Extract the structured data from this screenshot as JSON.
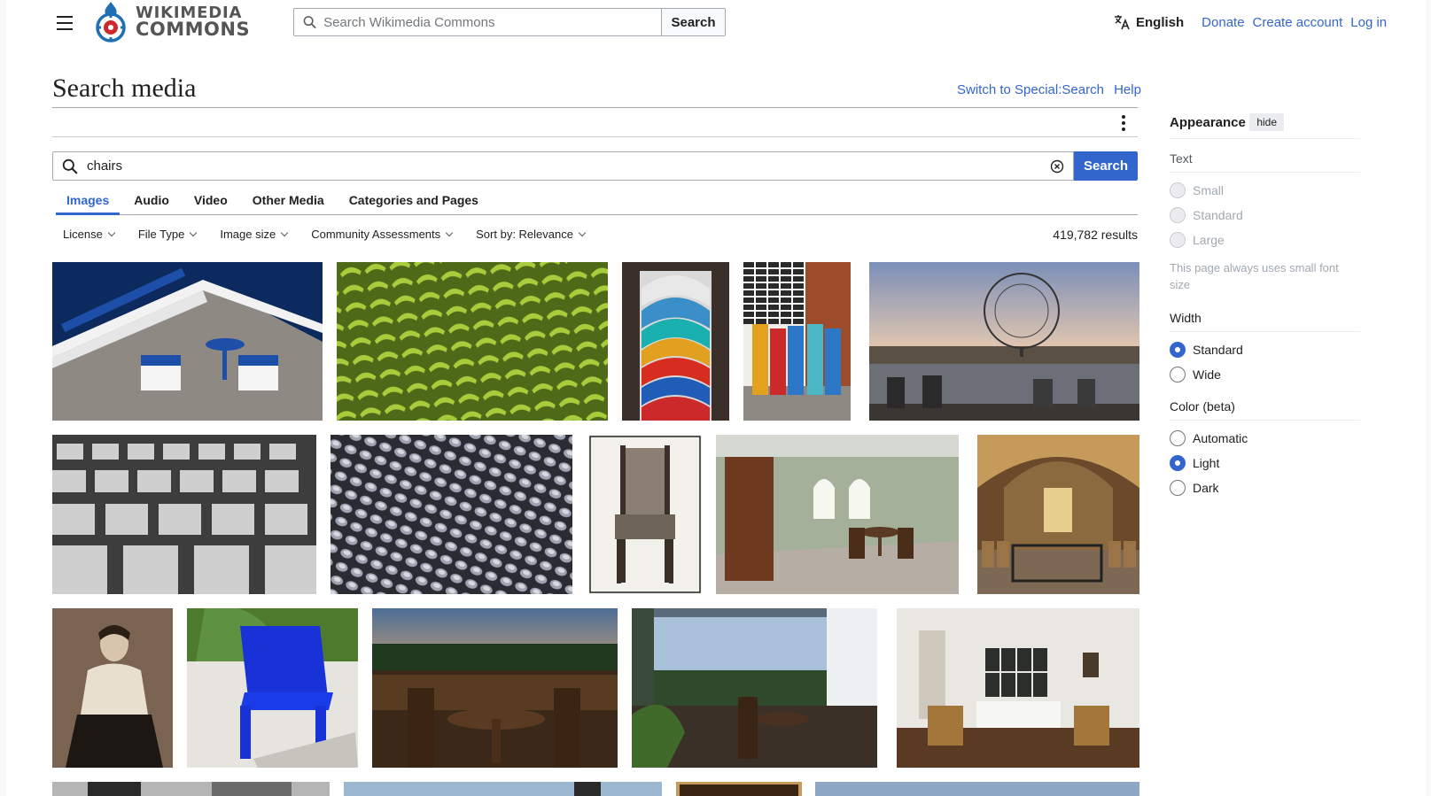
{
  "header": {
    "logo_line1": "WIKIMEDIA",
    "logo_line2": "COMMONS",
    "search_placeholder": "Search Wikimedia Commons",
    "search_button": "Search",
    "language": "English",
    "links": [
      "Donate",
      "Create account",
      "Log in"
    ]
  },
  "title": {
    "text": "Search media",
    "links": [
      "Switch to Special:Search",
      "Help"
    ]
  },
  "search": {
    "query": "chairs",
    "button": "Search"
  },
  "tabs": [
    {
      "label": "Images",
      "active": true
    },
    {
      "label": "Audio",
      "active": false
    },
    {
      "label": "Video",
      "active": false
    },
    {
      "label": "Other Media",
      "active": false
    },
    {
      "label": "Categories and Pages",
      "active": false
    }
  ],
  "filters": [
    "License",
    "File Type",
    "Image size",
    "Community Assessments",
    "Sort by: Relevance"
  ],
  "results": "419,782 results",
  "appearance": {
    "title": "Appearance",
    "hide": "hide",
    "text_section": "Text",
    "text_options": [
      "Small",
      "Standard",
      "Large"
    ],
    "text_note": "This page always uses small font size",
    "width_section": "Width",
    "width_options": [
      "Standard",
      "Wide"
    ],
    "width_selected": "Standard",
    "color_section": "Color (beta)",
    "color_options": [
      "Automatic",
      "Light",
      "Dark"
    ],
    "color_selected": "Light"
  },
  "colors": {
    "accent": "#3366cc",
    "text": "#202122",
    "border": "#a2a9b1"
  }
}
